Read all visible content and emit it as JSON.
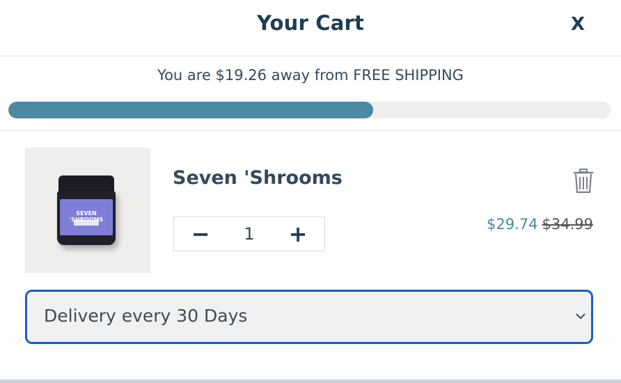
{
  "header": {
    "title": "Your Cart",
    "close_label": "X"
  },
  "shipping": {
    "message": "You are $19.26 away from FREE SHIPPING",
    "progress_percent": 60.6,
    "accent_color": "#4a8aa3"
  },
  "cart": {
    "items": [
      {
        "name": "Seven 'Shrooms",
        "image_label": "SEVEN 'SHROOMS",
        "quantity": "1",
        "minus_label": "−",
        "plus_label": "+",
        "sale_price": "$29.74",
        "original_price": "$34.99",
        "remove_icon": "trash-icon"
      }
    ],
    "subscription": {
      "selected_option": "Delivery every 30 Days",
      "accent_color": "#1a5ec2"
    }
  }
}
